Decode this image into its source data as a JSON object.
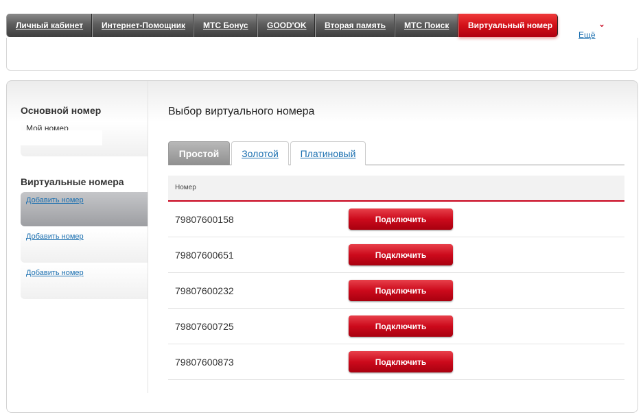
{
  "topnav": {
    "items": [
      {
        "label": "Личный кабинет"
      },
      {
        "label": "Интернет-Помощник"
      },
      {
        "label": "МТС Бонус"
      },
      {
        "label": "GOOD'OK"
      },
      {
        "label": "Вторая память"
      },
      {
        "label": "МТС Поиск"
      },
      {
        "label": "Виртуальный номер"
      }
    ],
    "active_index": 6,
    "more_label": "Ещё",
    "more_arrow": "⌄"
  },
  "sidebar": {
    "main_heading": "Основной номер",
    "main_label": "Мой номер",
    "virtual_heading": "Виртуальные номера",
    "slots": [
      {
        "label": "Добавить номер"
      },
      {
        "label": "Добавить номер"
      },
      {
        "label": "Добавить номер"
      }
    ]
  },
  "content": {
    "title": "Выбор виртуального номера",
    "tabs": [
      {
        "label": "Простой"
      },
      {
        "label": "Золотой"
      },
      {
        "label": "Платиновый"
      }
    ],
    "active_tab": 0,
    "table_header": "Номер",
    "rows": [
      {
        "number": "79807600158",
        "button": "Подключить"
      },
      {
        "number": "79807600651",
        "button": "Подключить"
      },
      {
        "number": "79807600232",
        "button": "Подключить"
      },
      {
        "number": "79807600725",
        "button": "Подключить"
      },
      {
        "number": "79807600873",
        "button": "Подключить"
      }
    ]
  },
  "colors": {
    "accent_red": "#c8001a",
    "link_blue": "#1a6fb0"
  }
}
